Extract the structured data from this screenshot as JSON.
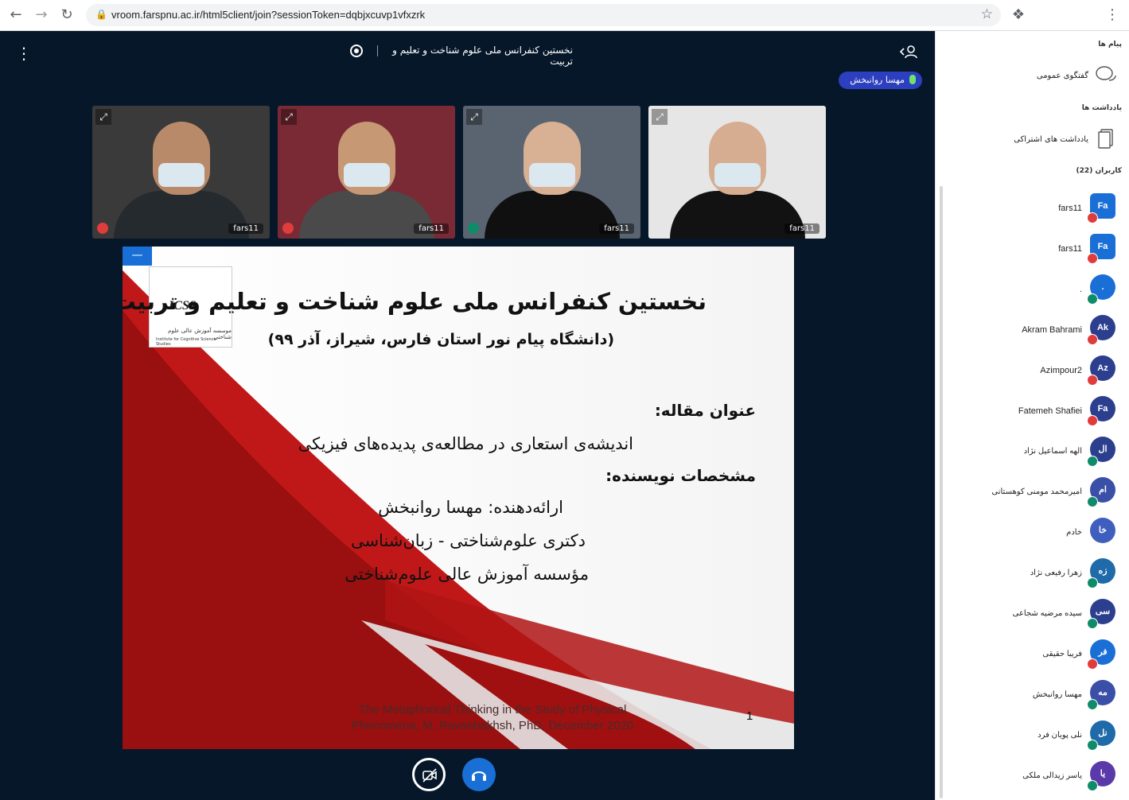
{
  "browser": {
    "url": "vroom.farspnu.ac.ir/html5client/join?sessionToken=dqbjxcuvp1vfxzrk"
  },
  "meeting": {
    "title": "نخستین کنفرانس ملی علوم شناخت و تعلیم و تربیت",
    "talking_user": "مهسا روانبخش"
  },
  "videos": [
    {
      "name": "fars11",
      "status": "muted",
      "colors": {
        "bg": "#3a3a3a",
        "face": "#b98a6a",
        "body": "#252a2e"
      }
    },
    {
      "name": "fars11",
      "status": "muted",
      "colors": {
        "bg": "#7a2a35",
        "face": "#c69873",
        "body": "#4a4a4a"
      }
    },
    {
      "name": "fars11",
      "status": "listen",
      "colors": {
        "bg": "#5a6470",
        "face": "#d8b094",
        "body": "#101010"
      }
    },
    {
      "name": "fars11",
      "status": "none",
      "colors": {
        "bg": "#e6e6e6",
        "face": "#d6ad90",
        "body": "#121212"
      }
    }
  ],
  "slide": {
    "logo_text": "ICSS",
    "logo_fa": "موسسه آموزش عالی علوم شناختی",
    "logo_en": "Institute for Cognitive Science Studies",
    "title": "نخستین کنفرانس ملی علوم شناخت و تعلیم و تربیت",
    "subtitle": "(دانشگاه پیام نور استان فارس، شیراز، آذر ۹۹)",
    "article_heading": "عنوان مقاله:",
    "article_title": "اندیشه‌ی استعاری در مطالعه‌ی پدیده‌های فیزیکی",
    "author_heading": "مشخصات نویسنده:",
    "presenter": "ارائه‌دهنده: مهسا روانبخش",
    "degree": "دکتری علوم‌شناختی - زبان‌شناسی",
    "institute": "مؤسسه آموزش عالی علوم‌شناختی",
    "footer_line1": "The Metaphorical Thinking in the Study of Physical",
    "footer_line2": "Phenomena, M. Ravanbakhsh, PhD, December 2020",
    "page": "1"
  },
  "sidebar": {
    "messages_heading": "پیام ها",
    "public_chat": "گفتگوی عمومی",
    "notes_heading": "یادداشت ها",
    "shared_notes": "یادداشت های اشتراکی",
    "users_heading": "کاربران (22)"
  },
  "users": [
    {
      "name": "fars11",
      "initials": "Fa",
      "color": "#1a6fd6",
      "badge": "muted",
      "round": false
    },
    {
      "name": "fars11",
      "initials": "Fa",
      "color": "#1a6fd6",
      "badge": "muted",
      "round": false
    },
    {
      "name": ".",
      "initials": ".",
      "color": "#1a6fd6",
      "badge": "listen",
      "round": true
    },
    {
      "name": "Akram Bahrami",
      "initials": "Ak",
      "color": "#2c3f8f",
      "badge": "muted",
      "round": true
    },
    {
      "name": "Azimpour2",
      "initials": "Az",
      "color": "#2c3f8f",
      "badge": "muted",
      "round": true
    },
    {
      "name": "Fatemeh Shafiei",
      "initials": "Fa",
      "color": "#2c3f8f",
      "badge": "muted",
      "round": true
    },
    {
      "name": "الهه اسماعیل نژاد",
      "initials": "ال",
      "color": "#2c3f8f",
      "badge": "listen",
      "round": true
    },
    {
      "name": "امیرمحمد مومنی کوهستانی",
      "initials": "ام",
      "color": "#3a4fa8",
      "badge": "listen",
      "round": true
    },
    {
      "name": "خادم",
      "initials": "خا",
      "color": "#3f5fbf",
      "badge": "none",
      "round": true
    },
    {
      "name": "زهرا رفیعی نژاد",
      "initials": "زه",
      "color": "#1f6aa8",
      "badge": "listen",
      "round": true
    },
    {
      "name": "سیده مرضیه شجاعی",
      "initials": "سی",
      "color": "#2c3f8f",
      "badge": "listen",
      "round": true
    },
    {
      "name": "فریبا حقیقی",
      "initials": "فر",
      "color": "#1a6fd6",
      "badge": "muted",
      "round": true
    },
    {
      "name": "مهسا روانبخش",
      "initials": "مه",
      "color": "#3a4fa8",
      "badge": "listen",
      "round": true
    },
    {
      "name": "نلی پویان فرد",
      "initials": "نل",
      "color": "#1f6aa8",
      "badge": "listen",
      "round": true
    },
    {
      "name": "یاسر زیدالی ملکی",
      "initials": "یا",
      "color": "#5a3aa8",
      "badge": "listen",
      "round": true
    }
  ]
}
